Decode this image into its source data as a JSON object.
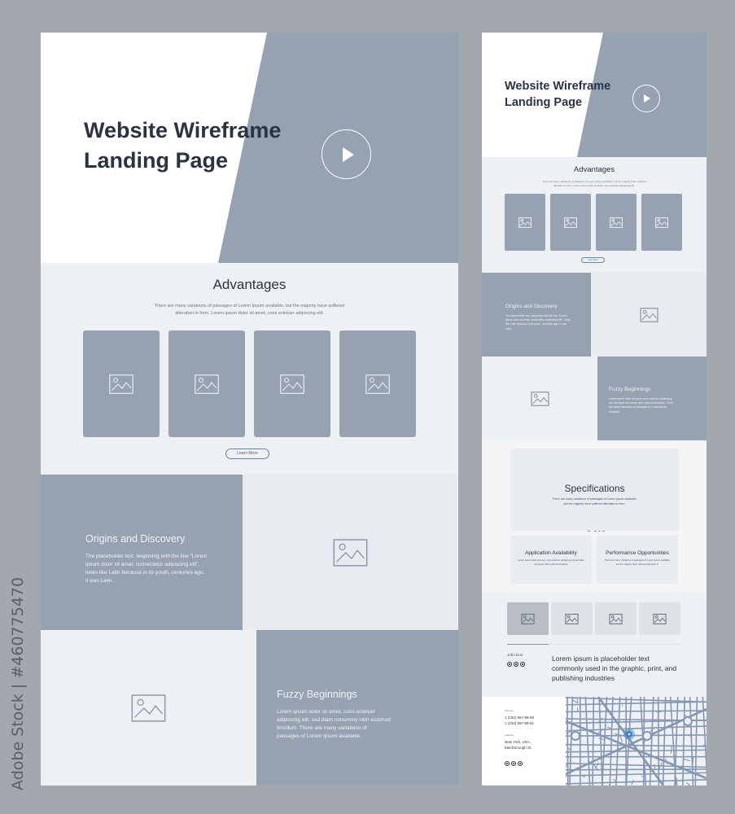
{
  "watermark": {
    "side_label": "Adobe Stock | #460775470",
    "overlay_text": "Adobe Stock"
  },
  "colors": {
    "background": "#a3a8ae",
    "accent_block": "#96a2b2",
    "page_bg": "#eef1f4",
    "heading": "#2a3441",
    "button_border": "#6a86a8",
    "map_pin": "#3b82c4"
  },
  "desktop": {
    "hero": {
      "title_line1": "Website Wireframe",
      "title_line2": "Landing Page",
      "play_icon": "play-icon"
    },
    "advantages": {
      "title": "Advantages",
      "description": "There are many variations of passages of Lorem Ipsum available, but the majority have suffered alteration in form. Lorem ipsum dolor sit amet, cons ectetuer adipiscing elit.",
      "cards": [
        {
          "icon": "image-placeholder-icon"
        },
        {
          "icon": "image-placeholder-icon"
        },
        {
          "icon": "image-placeholder-icon"
        },
        {
          "icon": "image-placeholder-icon"
        }
      ],
      "button_label": "Learn More"
    },
    "origins": {
      "title": "Origins and Discovery",
      "text": "The placeholder text, beginning with the line “Lorem ipsum dolor sit amet, consectetur adipiscing elit”, looks like Latin because in its youth, centuries ago, it was Latin."
    },
    "fuzzy": {
      "title": "Fuzzy Beginnings",
      "text": "Lorem ipsum dolor sit amet, cons ectetuer adipiscing elit, sed diam nonummy nibh euismod tincidunt. There are many variations of passages of Lorem Ipsum available."
    }
  },
  "mobile": {
    "hero": {
      "title_line1": "Website Wireframe",
      "title_line2": "Landing Page"
    },
    "advantages": {
      "title": "Advantages",
      "description": "There are many variations of passages of Lorem Ipsum available, but the majority have suffered alteration in form. Lorem ipsum dolor sit amet, cons ectetuer adipiscing elit.",
      "button_label": "Learn More"
    },
    "origins": {
      "title": "Origins and Discovery",
      "text": "The placeholder text, beginning with the line “Lorem ipsum dolor sit amet, consectetur adipiscing elit”, looks like Latin because in its youth, centuries ago, it was Latin."
    },
    "fuzzy": {
      "title": "Fuzzy Beginnings",
      "text": "Lorem ipsum dolor sit amet, cons ectetuer adipiscing elit, sed diam nonummy nibh euismod tincidunt. There are many variations of passages of Lorem Ipsum available."
    },
    "specifications": {
      "title": "Specifications",
      "description": "There are many variations of passages of Lorem Ipsum available, but the majority have suffered alteration in form.",
      "slider_dots": 4,
      "features": [
        {
          "title": "Application Availability",
          "text": "Lorem ipsum dolor sit amet, cons ectetuer adipiscing elit sed diam nonummy nibh euismod tincidunt."
        },
        {
          "title": "Performance Opportunities",
          "text": "There are many variations of passages of Lorem Ipsum available, but the majority have suffered alteration in"
        }
      ]
    },
    "testimonial": {
      "gallery_count": 4,
      "active_index": 0,
      "author": "John Doe",
      "quote": "Lorem ipsum is placeholder text commonly used in the graphic, print, and publishing industries",
      "social_icons": [
        "social-icon-1",
        "social-icon-2",
        "social-icon-3"
      ]
    },
    "contact": {
      "phones_label": "Phones",
      "phone1": "1 (234) 567-89-90",
      "phone2": "1 (234) 567-89-91",
      "address_label": "Address",
      "address_line1": "New York, USA,",
      "address_line2": "MacDonough St.",
      "social_icons": [
        "social-icon-1",
        "social-icon-2",
        "social-icon-3"
      ]
    }
  }
}
